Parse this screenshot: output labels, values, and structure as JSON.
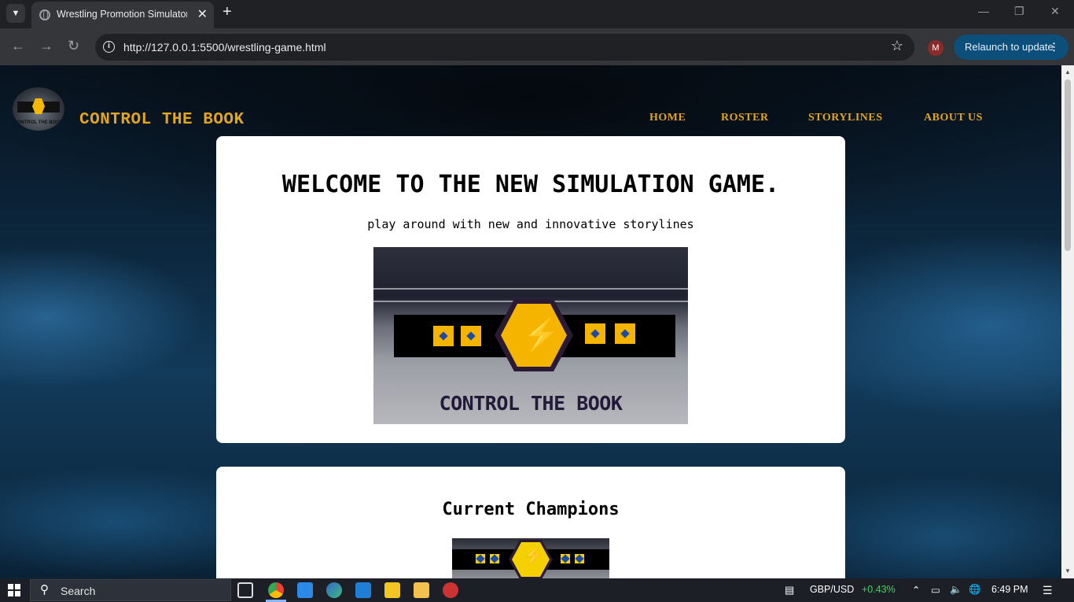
{
  "browser": {
    "tab_title": "Wrestling Promotion Simulator",
    "url": "http://127.0.0.1:5500/wrestling-game.html",
    "profile_initial": "M",
    "relaunch_label": "Relaunch to update"
  },
  "site": {
    "brand": "CONTROL THE BOOK",
    "logo_text": "CONTROL THE BOOK",
    "nav": [
      "HOME",
      "ROSTER",
      "STORYLINES",
      "ABOUT US"
    ]
  },
  "hero": {
    "title": "WELCOME TO THE NEW SIMULATION GAME.",
    "subtitle": "play around with new and innovative storylines",
    "image_text": "CONTROL THE BOOK"
  },
  "champions": {
    "title": "Current Champions"
  },
  "taskbar": {
    "search_label": "Search",
    "ticker": "GBP/USD",
    "ticker_change": "+0.43%",
    "time": "6:49 PM"
  },
  "colors": {
    "accent": "#e2a61b",
    "relaunch_bg": "#0b4f7a",
    "ticker_up": "#3fd06b",
    "plate_gold": "#f4b400"
  }
}
